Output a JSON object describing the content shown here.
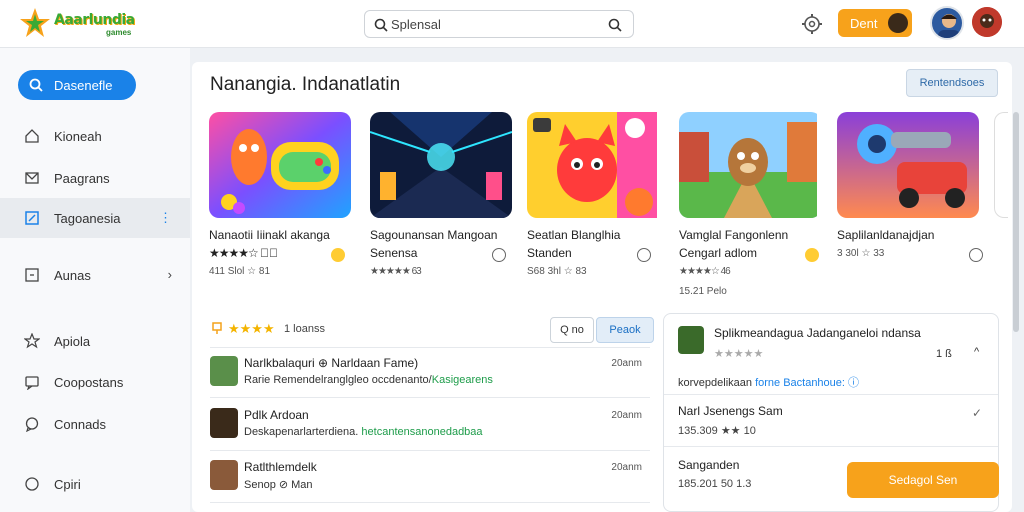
{
  "app": {
    "logo_text": "Aaarlundia",
    "logo_sub": "games"
  },
  "search": {
    "placeholder": "Splensal"
  },
  "topbar": {
    "button_label": "Dent"
  },
  "sidebar": {
    "active": {
      "label": "Dasenefle"
    },
    "items": [
      {
        "label": "Kioneah",
        "icon": "home-icon"
      },
      {
        "label": "Paagrans",
        "icon": "mail-icon"
      },
      {
        "label": "Tagoanesia",
        "icon": "edit-icon",
        "more": "⋮"
      },
      {
        "label": "Aunas",
        "icon": "box-icon",
        "more": "›"
      },
      {
        "label": "Apiola",
        "icon": "star-icon"
      },
      {
        "label": "Coopostans",
        "icon": "chat-icon"
      },
      {
        "label": "Connads",
        "icon": "bubble-icon"
      },
      {
        "label": "Cpiri",
        "icon": "circle-icon"
      }
    ]
  },
  "main": {
    "title": "Nanangia. Indanatlatin",
    "button_label": "Rentendsoes"
  },
  "cards": [
    {
      "title": "Nanaotii Iiinakl akanga",
      "sub": "★★★★☆ ℹ⃝",
      "meta": "411 Slol ☆ 81",
      "meta2": ""
    },
    {
      "title": "Sagounansan Mangoan",
      "sub": "Senensa",
      "meta": "★★★★★ 63",
      "meta2": ""
    },
    {
      "title": "Seatlan Blanglhia",
      "sub": "Standen",
      "meta": "S68 3hl ☆ 83",
      "meta2": ""
    },
    {
      "title": "Vamglal Fangonlenn",
      "sub": "Cengarl adlom",
      "meta": "★★★★☆ 46",
      "meta2": "15.21 Pelo"
    },
    {
      "title": "Saplilanldanajdjan",
      "sub": "",
      "meta": "3 30l ☆ 33",
      "meta2": ""
    }
  ],
  "reviews": {
    "header_label": "1 loanss",
    "btn_search": "Q no",
    "btn_active": "Peaok",
    "rows": [
      {
        "name": "Narlkbalaquri ⊕ Narldaan Fame)",
        "text_a": "Rarie Remendelranglgleo occdenanto/",
        "text_b": "Kasigearens",
        "time": "20anm"
      },
      {
        "name": "Pdlk Ardoan",
        "text_a": "Deskapenarlarterdiena.",
        "text_b": "hetcantensanonedadbaa",
        "time": "20anm"
      },
      {
        "name": "Ratlthlemdelk",
        "text_a": "Senop ⊘ Man",
        "text_b": "",
        "time": "20anm"
      }
    ]
  },
  "detail": {
    "title": "Splikmeandagua Jadanganeloi ndansa",
    "stars": "★★★★★",
    "count": "1 ß",
    "desc_a": "korvepdelikaan ",
    "desc_b": "forne Bactanhoue: ⓘ",
    "item1": "Narl Jsenengs Sam",
    "item1_meta": "135.309 ★★ 10",
    "item2": "Sanganden",
    "item2_meta": "185.201 50 1.3",
    "cta": "Sedagol Sen"
  },
  "colors": {
    "accent_blue": "#1a82e8",
    "accent_orange": "#f7a21b",
    "star": "#f4b400"
  }
}
